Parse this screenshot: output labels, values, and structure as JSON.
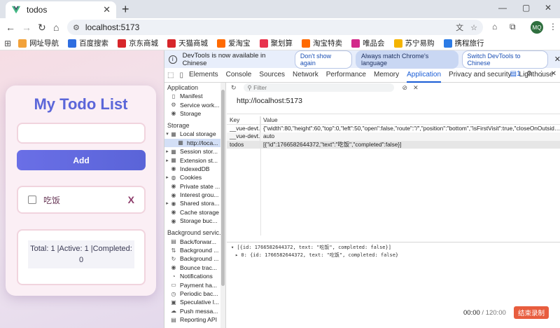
{
  "browser": {
    "tab_title": "todos",
    "new_tab": "+",
    "url": "localhost:5173",
    "avatar": "MQ",
    "window_controls": [
      "—",
      "▢",
      "✕"
    ]
  },
  "bookmarks": [
    {
      "label": "网址导航",
      "color": "#f2a23a"
    },
    {
      "label": "百度搜索",
      "color": "#2f6ee0"
    },
    {
      "label": "京东商城",
      "color": "#d7262a"
    },
    {
      "label": "天猫商城",
      "color": "#d7262a"
    },
    {
      "label": "爱淘宝",
      "color": "#ff6a00"
    },
    {
      "label": "聚划算",
      "color": "#e8344d"
    },
    {
      "label": "淘宝特卖",
      "color": "#ff6a00"
    },
    {
      "label": "唯品会",
      "color": "#d2298a"
    },
    {
      "label": "苏宁易购",
      "color": "#f4b400"
    },
    {
      "label": "携程旅行",
      "color": "#2c7be5"
    }
  ],
  "app": {
    "title": "My Todo List",
    "input_value": "",
    "add_label": "Add",
    "todos": [
      {
        "text": "吃饭",
        "completed": false,
        "delete_label": "X"
      }
    ],
    "stats": "Total: 1 |Active: 1 |Completed: 0"
  },
  "devtools": {
    "banner": {
      "message": "DevTools is now available in Chinese",
      "dont_show": "Don't show again",
      "always_match": "Always match Chrome's language",
      "switch": "Switch DevTools to Chinese"
    },
    "tabs": [
      "Elements",
      "Console",
      "Sources",
      "Network",
      "Performance",
      "Memory",
      "Application",
      "Privacy and security",
      "Lighthouse"
    ],
    "active_tab": "Application",
    "more_tabs": "≫",
    "issues_count": "1",
    "sidebar": {
      "application_header": "Application",
      "application_items": [
        "Manifest",
        "Service work...",
        "Storage"
      ],
      "storage_header": "Storage",
      "storage_items": [
        "Local storage",
        "http://loca...",
        "Session stor...",
        "Extension st...",
        "IndexedDB",
        "Cookies",
        "Private state ...",
        "Interest grou...",
        "Shared stora...",
        "Cache storage",
        "Storage buc..."
      ],
      "background_header": "Background servic...",
      "background_items": [
        "Back/forwar...",
        "Background ...",
        "Background ...",
        "Bounce trac...",
        "Notifications",
        "Payment ha...",
        "Periodic bac...",
        "Speculative l...",
        "Push messa...",
        "Reporting API"
      ]
    },
    "filter_placeholder": "Filter",
    "origin": "http://localhost:5173",
    "table": {
      "headers": [
        "Key",
        "Value"
      ],
      "rows": [
        {
          "key": "__vue-devt...",
          "value": "{\"width\":80,\"height\":60,\"top\":0,\"left\":50,\"open\":false,\"route\":\"/\",\"position\":\"bottom\",\"isFirstVisit\":true,\"closeOnOutsideClick\":false,..."
        },
        {
          "key": "__vue-devt...",
          "value": "auto"
        },
        {
          "key": "todos",
          "value": "[{\"id\":1766582644372,\"text\":\"吃饭\",\"completed\":false}]"
        }
      ]
    },
    "preview": {
      "line1": "▾ [{id: 1766582644372, text: \"吃饭\", completed: false}]",
      "line2": "▸ 0: {id: 1766582644372, text: \"吃饭\", completed: false}"
    },
    "recorder": {
      "elapsed": "00:00",
      "separator": " / ",
      "total": "120:00",
      "stop_label": "结束录制"
    }
  }
}
